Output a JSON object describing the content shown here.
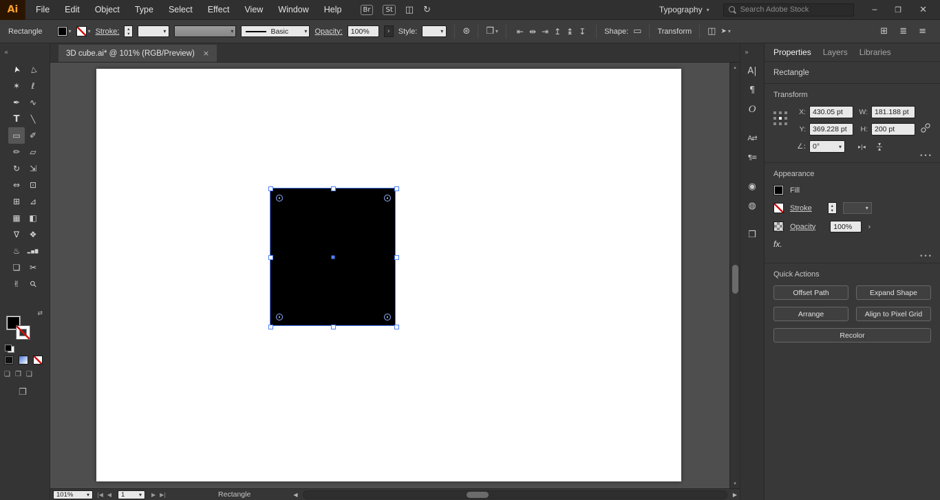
{
  "colors": {
    "selection": "#4e80ff",
    "logo_bg": "#2b1500",
    "logo_fg": "#ffa02e"
  },
  "glyphs": {
    "chevron_down": "▾",
    "chevron_up": "▴",
    "chevron_right": "›",
    "more": "•••",
    "close_x": "✕",
    "minimize": "─",
    "restore": "❐",
    "close_tab": "×",
    "arrow_left": "◀",
    "arrow_right": "▶"
  },
  "menubar": {
    "logo_label": "Ai",
    "menus": [
      "File",
      "Edit",
      "Object",
      "Type",
      "Select",
      "Effect",
      "View",
      "Window",
      "Help"
    ],
    "icons": [
      {
        "name": "bridge-icon",
        "glyph": "Br",
        "box": true
      },
      {
        "name": "stock-icon",
        "glyph": "St",
        "box": true
      },
      {
        "name": "arrange-documents-icon",
        "glyph": "◫",
        "box": false
      },
      {
        "name": "sync-settings-icon",
        "glyph": "↻",
        "box": false
      }
    ],
    "workspace": "Typography",
    "search_placeholder": "Search Adobe Stock"
  },
  "control_bar": {
    "context_label": "Rectangle",
    "stroke_label": "Stroke:",
    "brush_name": "Basic",
    "opacity_label": "Opacity:",
    "opacity_value": "100%",
    "style_label": "Style:",
    "shape_label": "Shape:",
    "transform_label": "Transform",
    "icons": {
      "color_wheel": "⊛",
      "document": "❒",
      "shape": "▭",
      "isolate": "◫",
      "select_similar": "➤",
      "workspace": "⊞",
      "dock": "≣",
      "menu": "≡"
    },
    "align_icons": [
      {
        "name": "align-horizontal-left-icon",
        "glyph": "⇤"
      },
      {
        "name": "align-horizontal-center-icon",
        "glyph": "⇹"
      },
      {
        "name": "align-horizontal-right-icon",
        "glyph": "⇥"
      },
      {
        "name": "align-vertical-top-icon",
        "glyph": "↥"
      },
      {
        "name": "align-vertical-center-icon",
        "glyph": "↨"
      },
      {
        "name": "align-vertical-bottom-icon",
        "glyph": "↧"
      }
    ]
  },
  "toolbar": {
    "collapse_glyph": "«",
    "swap_glyph": "⇄",
    "mode_glyphs": [
      "❏",
      "❐",
      "❑"
    ],
    "screen_mode_glyph": "❐",
    "tools": [
      {
        "name": "selection-tool",
        "glyph": "➤"
      },
      {
        "name": "direct-selection-tool",
        "glyph": "▷"
      },
      {
        "name": "magic-wand-tool",
        "glyph": "✶"
      },
      {
        "name": "lasso-tool",
        "glyph": "ℓ"
      },
      {
        "name": "pen-tool",
        "glyph": "✒"
      },
      {
        "name": "curvature-tool",
        "glyph": "∿"
      },
      {
        "name": "type-tool",
        "glyph": "T"
      },
      {
        "name": "line-segment-tool",
        "glyph": "╲"
      },
      {
        "name": "rectangle-tool",
        "glyph": "▭",
        "active": true
      },
      {
        "name": "paintbrush-tool",
        "glyph": "✐"
      },
      {
        "name": "shaper-tool",
        "glyph": "✏"
      },
      {
        "name": "eraser-tool",
        "glyph": "▱"
      },
      {
        "name": "rotate-tool",
        "glyph": "↻"
      },
      {
        "name": "scale-tool",
        "glyph": "⇲"
      },
      {
        "name": "width-tool",
        "glyph": "⇔"
      },
      {
        "name": "free-transform-tool",
        "glyph": "⊡"
      },
      {
        "name": "shape-builder-tool",
        "glyph": "⊞"
      },
      {
        "name": "perspective-grid-tool",
        "glyph": "⊿"
      },
      {
        "name": "mesh-tool",
        "glyph": "▦"
      },
      {
        "name": "gradient-tool",
        "glyph": "◧"
      },
      {
        "name": "eyedropper-tool",
        "glyph": "∇"
      },
      {
        "name": "blend-tool",
        "glyph": "❖"
      },
      {
        "name": "symbol-sprayer-tool",
        "glyph": "♨"
      },
      {
        "name": "column-graph-tool",
        "glyph": "▂▅▇"
      },
      {
        "name": "artboard-tool",
        "glyph": "❏"
      },
      {
        "name": "slice-tool",
        "glyph": "✂"
      },
      {
        "name": "hand-tool",
        "glyph": "✌"
      },
      {
        "name": "zoom-tool",
        "glyph": "⚲"
      }
    ]
  },
  "document": {
    "tab_title": "3D cube.ai* @ 101% (RGB/Preview)"
  },
  "canvas": {
    "shape": {
      "type": "Rectangle",
      "fill": "#000000"
    }
  },
  "panel_strip": {
    "collapse_glyph": "»",
    "icons": [
      {
        "name": "character-panel-icon",
        "glyph": "A|"
      },
      {
        "name": "paragraph-panel-icon",
        "glyph": "¶"
      },
      {
        "name": "opentype-panel-icon",
        "glyph": "O"
      },
      {
        "name": "character-styles-icon",
        "glyph": "A⇄"
      },
      {
        "name": "paragraph-styles-icon",
        "glyph": "¶≡"
      },
      {
        "name": "gradient-panel-icon",
        "glyph": "◉"
      },
      {
        "name": "symbols-panel-icon",
        "glyph": "◍"
      },
      {
        "name": "artboards-panel-icon",
        "glyph": "❒"
      }
    ]
  },
  "properties": {
    "tabs": [
      {
        "label": "Properties",
        "active": true
      },
      {
        "label": "Layers",
        "active": false
      },
      {
        "label": "Libraries",
        "active": false
      }
    ],
    "selection_type": "Rectangle",
    "transform": {
      "title": "Transform",
      "x_label": "X:",
      "x_value": "430.05 pt",
      "y_label": "Y:",
      "y_value": "369.228 pt",
      "w_label": "W:",
      "w_value": "181.188 pt",
      "h_label": "H:",
      "h_value": "200 pt",
      "angle_label": "∠:",
      "angle_value": "0°",
      "flip_glyph": "▸|◂"
    },
    "appearance": {
      "title": "Appearance",
      "fill_label": "Fill",
      "stroke_label": "Stroke",
      "opacity_label": "Opacity",
      "opacity_value": "100%",
      "fx_label": "fx."
    },
    "quick_actions": {
      "title": "Quick Actions",
      "buttons": [
        "Offset Path",
        "Expand Shape",
        "Arrange",
        "Align to Pixel Grid",
        "Recolor"
      ]
    }
  },
  "statusbar": {
    "zoom": "101%",
    "nav_first": "|◀",
    "nav_prev": "◀",
    "nav_next": "▶",
    "nav_last": "▶|",
    "artboard": "1",
    "status": "Rectangle"
  }
}
